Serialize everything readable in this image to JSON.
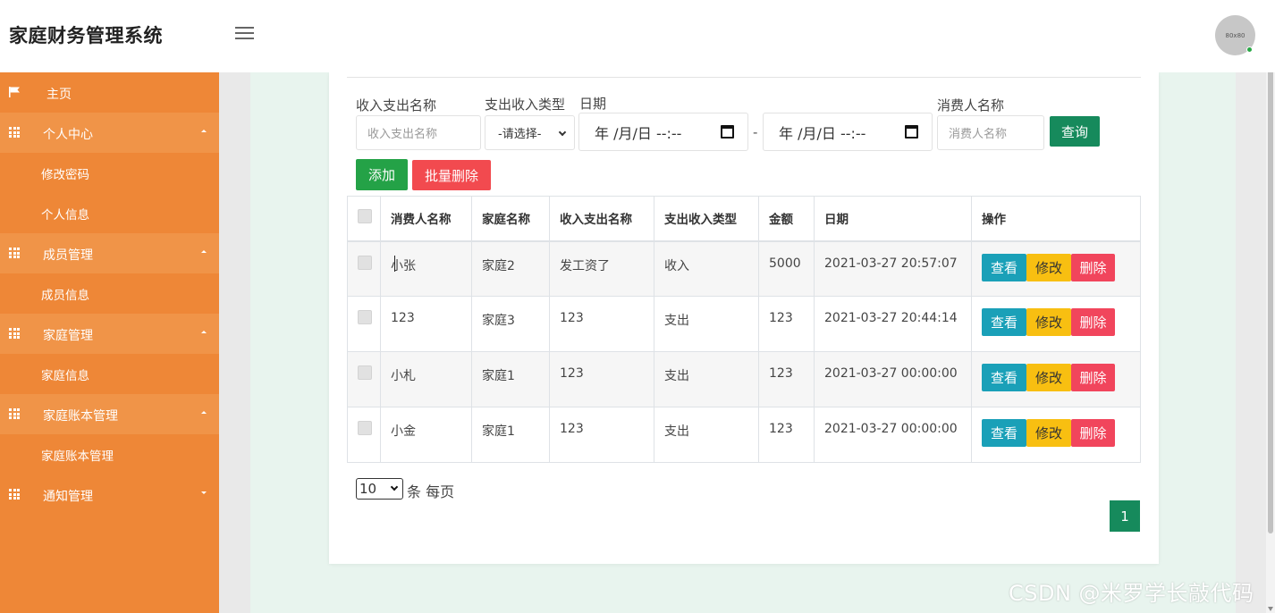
{
  "header": {
    "app_title": "家庭财务管理系统",
    "avatar_text": "80x80"
  },
  "sidebar": {
    "items": [
      {
        "label": "主页",
        "type": "home",
        "icon": "flag-icon"
      },
      {
        "label": "个人中心",
        "type": "group",
        "icon": "grid-icon",
        "caret": "up"
      },
      {
        "label": "修改密码",
        "type": "sub"
      },
      {
        "label": "个人信息",
        "type": "sub"
      },
      {
        "label": "成员管理",
        "type": "group",
        "icon": "grid-icon",
        "caret": "up"
      },
      {
        "label": "成员信息",
        "type": "sub"
      },
      {
        "label": "家庭管理",
        "type": "group",
        "icon": "grid-icon",
        "caret": "up"
      },
      {
        "label": "家庭信息",
        "type": "sub"
      },
      {
        "label": "家庭账本管理",
        "type": "group",
        "icon": "grid-icon",
        "caret": "up"
      },
      {
        "label": "家庭账本管理",
        "type": "sub"
      },
      {
        "label": "通知管理",
        "type": "group",
        "icon": "grid-icon",
        "caret": "down"
      }
    ]
  },
  "filters": {
    "name_label": "收入支出名称",
    "name_placeholder": "收入支出名称",
    "type_label": "支出收入类型",
    "type_selected": "-请选择-",
    "date_label": "日期",
    "date_from": "年 /月/日  --:--",
    "date_sep": "-",
    "date_to": "年 /月/日  --:--",
    "consumer_label": "消费人名称",
    "consumer_placeholder": "消费人名称",
    "search_button": "查询"
  },
  "actions": {
    "add_button": "添加",
    "batch_delete_button": "批量删除"
  },
  "table": {
    "columns": [
      "消费人名称",
      "家庭名称",
      "收入支出名称",
      "支出收入类型",
      "金额",
      "日期",
      "操作"
    ],
    "rows": [
      {
        "consumer": "小张",
        "family": "家庭2",
        "name": "发工资了",
        "type": "收入",
        "amount": "5000",
        "date": "2021-03-27 20:57:07"
      },
      {
        "consumer": "123",
        "family": "家庭3",
        "name": "123",
        "type": "支出",
        "amount": "123",
        "date": "2021-03-27 20:44:14"
      },
      {
        "consumer": "小札",
        "family": "家庭1",
        "name": "123",
        "type": "支出",
        "amount": "123",
        "date": "2021-03-27 00:00:00"
      },
      {
        "consumer": "小金",
        "family": "家庭1",
        "name": "123",
        "type": "支出",
        "amount": "123",
        "date": "2021-03-27 00:00:00"
      }
    ],
    "op_view": "查看",
    "op_edit": "修改",
    "op_delete": "删除"
  },
  "pagination": {
    "page_size": "10",
    "per_page_text": "条 每页",
    "current_page": "1"
  },
  "watermark": "CSDN @米罗学长敲代码",
  "colors": {
    "sidebar_bg": "#ee8737",
    "sidebar_group_bg": "#f09448",
    "primary_green": "#168a5c",
    "add_green": "#24a247",
    "danger": "#f24a4f",
    "info": "#1aa0b8",
    "warning": "#f8bf11"
  }
}
